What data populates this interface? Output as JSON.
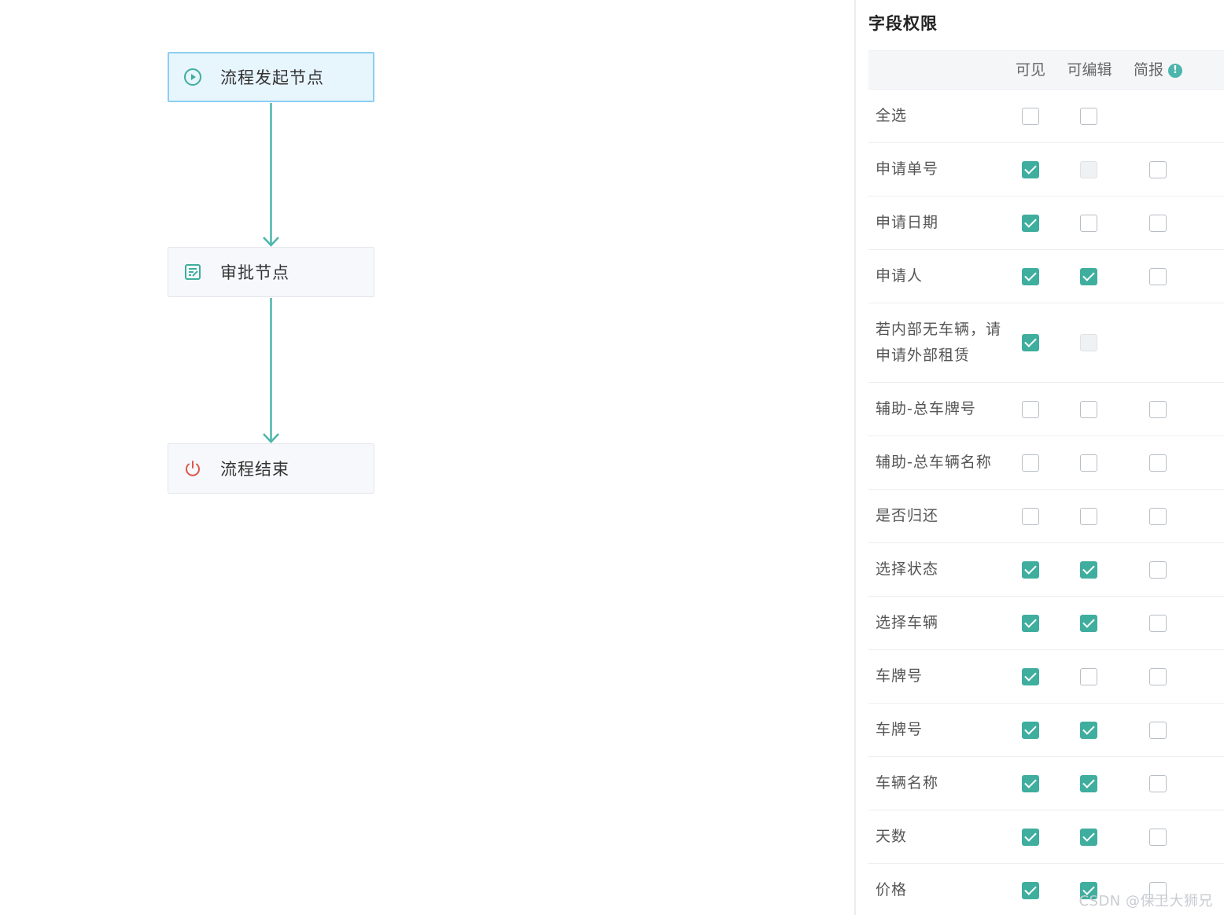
{
  "flow": {
    "nodes": [
      {
        "key": "start",
        "label": "流程发起节点",
        "icon": "play-circle-icon",
        "selected": true
      },
      {
        "key": "approve",
        "label": "审批节点",
        "icon": "approval-form-icon",
        "selected": false
      },
      {
        "key": "end",
        "label": "流程结束",
        "icon": "power-icon",
        "selected": false
      }
    ],
    "colors": {
      "edge": "#4db6ac",
      "start_icon": "#3fae9e",
      "approve_icon": "#3fae9e",
      "end_icon": "#e0544b",
      "selected_border": "#8ccef2",
      "selected_bg": "#e7f5fd"
    }
  },
  "panel": {
    "title": "字段权限",
    "columns": {
      "visible": "可见",
      "editable": "可编辑",
      "brief": "简报",
      "brief_info_icon": "info-icon"
    },
    "rows": [
      {
        "name": "全选",
        "visible": "off",
        "editable": "off",
        "brief": "none"
      },
      {
        "name": "申请单号",
        "visible": "on",
        "editable": "disabled",
        "brief": "off"
      },
      {
        "name": "申请日期",
        "visible": "on",
        "editable": "off",
        "brief": "off"
      },
      {
        "name": "申请人",
        "visible": "on",
        "editable": "on",
        "brief": "off"
      },
      {
        "name": "若内部无车辆，请申请外部租赁",
        "visible": "on",
        "editable": "disabled",
        "brief": "none",
        "tall": true
      },
      {
        "name": "辅助-总车牌号",
        "visible": "off",
        "editable": "off",
        "brief": "off"
      },
      {
        "name": "辅助-总车辆名称",
        "visible": "off",
        "editable": "off",
        "brief": "off"
      },
      {
        "name": "是否归还",
        "visible": "off",
        "editable": "off",
        "brief": "off"
      },
      {
        "name": "选择状态",
        "visible": "on",
        "editable": "on",
        "brief": "off"
      },
      {
        "name": "选择车辆",
        "visible": "on",
        "editable": "on",
        "brief": "off"
      },
      {
        "name": "车牌号",
        "visible": "on",
        "editable": "off",
        "brief": "off"
      },
      {
        "name": "车牌号",
        "visible": "on",
        "editable": "on",
        "brief": "off"
      },
      {
        "name": "车辆名称",
        "visible": "on",
        "editable": "on",
        "brief": "off"
      },
      {
        "name": "天数",
        "visible": "on",
        "editable": "on",
        "brief": "off"
      },
      {
        "name": "价格",
        "visible": "on",
        "editable": "on",
        "brief": "off"
      }
    ],
    "colors": {
      "checkbox_on": "#3fae9e",
      "header_bg": "#f5f6f8"
    }
  },
  "watermark": "CSDN @保卫大狮兄"
}
